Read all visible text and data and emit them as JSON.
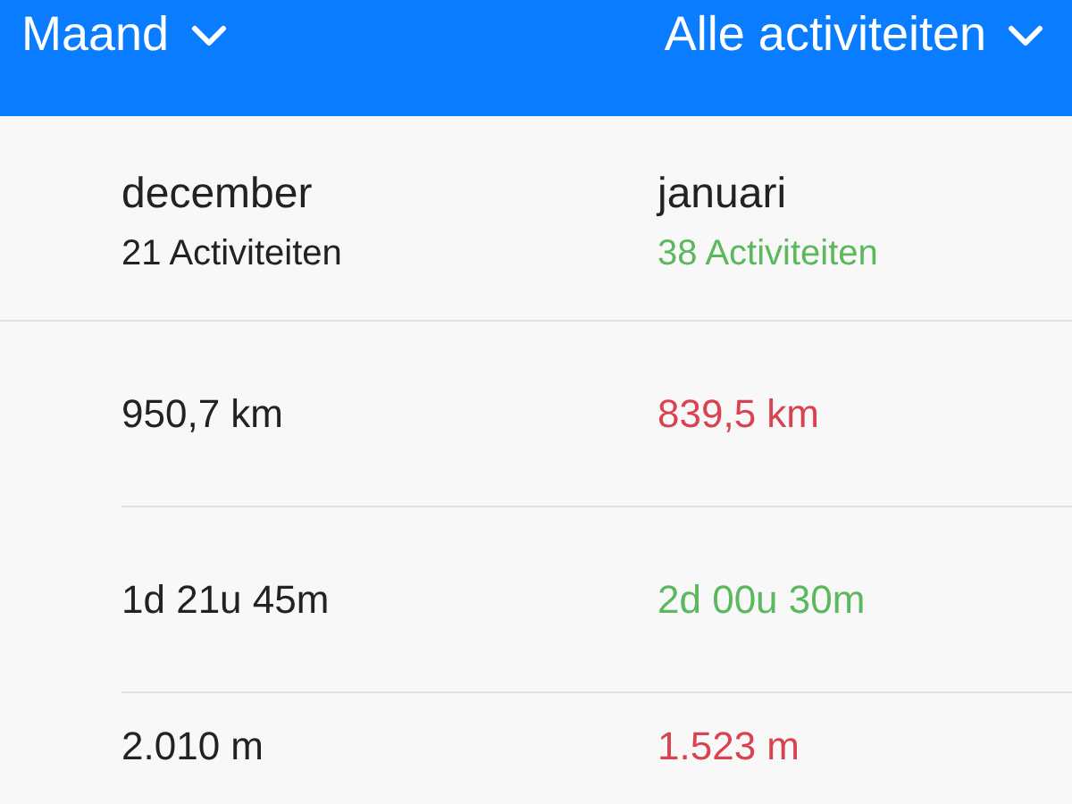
{
  "header": {
    "period_filter": {
      "label": "Maand"
    },
    "activity_filter": {
      "label": "Alle activiteiten"
    }
  },
  "months": [
    {
      "name": "december",
      "count": "21 Activiteiten",
      "color": "#222222"
    },
    {
      "name": "januari",
      "count": "38 Activiteiten",
      "color": "#5cb85c"
    }
  ],
  "rows": [
    {
      "previous": "950,7 km",
      "current": "839,5 km",
      "color": "#d9434f"
    },
    {
      "previous": "1d 21u 45m",
      "current": "2d 00u 30m",
      "color": "#5cb85c"
    },
    {
      "previous": "2.010 m",
      "current": "1.523 m",
      "color": "#d9434f"
    }
  ]
}
